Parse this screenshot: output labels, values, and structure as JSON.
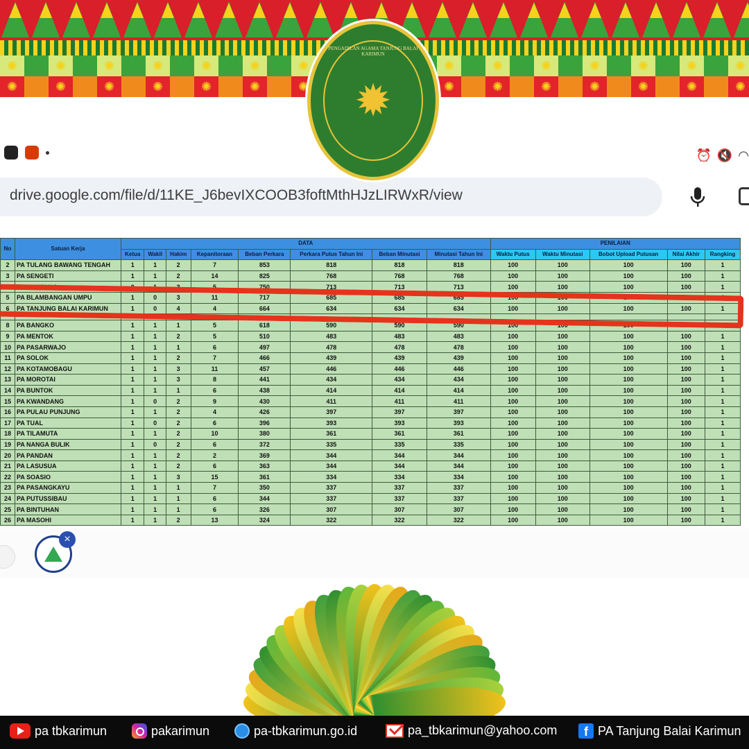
{
  "logo": {
    "text": "PENGADILAN AGAMA TANJUNG BALAI KARIMUN"
  },
  "browser": {
    "url": "drive.google.com/file/d/11KE_J6bevIXCOOB3foftMthHJzLIRWxR/view"
  },
  "sheet": {
    "group_headers": {
      "data": "DATA",
      "penilaian": "PENILAIAN"
    },
    "col_no": "No",
    "col_satuan": "Satuan Kerja",
    "columns": [
      "Ketua",
      "Wakil",
      "Hakim",
      "Kepanitoraan",
      "Beban Perkara",
      "Perkara Putus Tahun Ini",
      "Beban Minutasi",
      "Minutasi Tahun Ini",
      "Waktu Putus",
      "Waktu Minutasi",
      "Bobot Upload Putusan",
      "Nilai Akhir",
      "Rangking"
    ],
    "rows": [
      [
        "2",
        "PA TULANG BAWANG TENGAH",
        "1",
        "1",
        "2",
        "7",
        "853",
        "818",
        "818",
        "818",
        "100",
        "100",
        "100",
        "100",
        "1"
      ],
      [
        "3",
        "PA SENGETI",
        "1",
        "1",
        "2",
        "14",
        "825",
        "768",
        "768",
        "768",
        "100",
        "100",
        "100",
        "100",
        "1"
      ],
      [
        "4",
        "PA BONTANG",
        "0",
        "1",
        "3",
        "5",
        "750",
        "713",
        "713",
        "713",
        "100",
        "100",
        "100",
        "100",
        "1"
      ],
      [
        "5",
        "PA BLAMBANGAN UMPU",
        "1",
        "0",
        "3",
        "11",
        "717",
        "685",
        "685",
        "685",
        "100",
        "100",
        "100",
        "100",
        "1"
      ],
      [
        "6",
        "PA TANJUNG BALAI KARIMUN",
        "1",
        "0",
        "4",
        "4",
        "664",
        "634",
        "634",
        "634",
        "100",
        "100",
        "100",
        "100",
        "1"
      ],
      [
        "",
        "",
        "",
        "",
        "",
        "",
        "",
        "",
        "",
        "",
        "",
        "",
        "",
        "",
        ""
      ],
      [
        "8",
        "PA BANGKO",
        "1",
        "1",
        "1",
        "5",
        "618",
        "590",
        "590",
        "590",
        "100",
        "100",
        "100",
        "100",
        "1"
      ],
      [
        "9",
        "PA MENTOK",
        "1",
        "1",
        "2",
        "5",
        "510",
        "483",
        "483",
        "483",
        "100",
        "100",
        "100",
        "100",
        "1"
      ],
      [
        "10",
        "PA PASARWAJO",
        "1",
        "1",
        "1",
        "6",
        "497",
        "478",
        "478",
        "478",
        "100",
        "100",
        "100",
        "100",
        "1"
      ],
      [
        "11",
        "PA SOLOK",
        "1",
        "1",
        "2",
        "7",
        "466",
        "439",
        "439",
        "439",
        "100",
        "100",
        "100",
        "100",
        "1"
      ],
      [
        "12",
        "PA KOTAMOBAGU",
        "1",
        "1",
        "3",
        "11",
        "457",
        "446",
        "446",
        "446",
        "100",
        "100",
        "100",
        "100",
        "1"
      ],
      [
        "13",
        "PA MOROTAI",
        "1",
        "1",
        "3",
        "8",
        "441",
        "434",
        "434",
        "434",
        "100",
        "100",
        "100",
        "100",
        "1"
      ],
      [
        "14",
        "PA BUNTOK",
        "1",
        "1",
        "1",
        "6",
        "438",
        "414",
        "414",
        "414",
        "100",
        "100",
        "100",
        "100",
        "1"
      ],
      [
        "15",
        "PA KWANDANG",
        "1",
        "0",
        "2",
        "9",
        "430",
        "411",
        "411",
        "411",
        "100",
        "100",
        "100",
        "100",
        "1"
      ],
      [
        "16",
        "PA PULAU PUNJUNG",
        "1",
        "1",
        "2",
        "4",
        "426",
        "397",
        "397",
        "397",
        "100",
        "100",
        "100",
        "100",
        "1"
      ],
      [
        "17",
        "PA TUAL",
        "1",
        "0",
        "2",
        "6",
        "396",
        "393",
        "393",
        "393",
        "100",
        "100",
        "100",
        "100",
        "1"
      ],
      [
        "18",
        "PA TILAMUTA",
        "1",
        "1",
        "2",
        "10",
        "380",
        "361",
        "361",
        "361",
        "100",
        "100",
        "100",
        "100",
        "1"
      ],
      [
        "19",
        "PA NANGA BULIK",
        "1",
        "0",
        "2",
        "6",
        "372",
        "335",
        "335",
        "335",
        "100",
        "100",
        "100",
        "100",
        "1"
      ],
      [
        "20",
        "PA PANDAN",
        "1",
        "1",
        "2",
        "2",
        "369",
        "344",
        "344",
        "344",
        "100",
        "100",
        "100",
        "100",
        "1"
      ],
      [
        "21",
        "PA LASUSUA",
        "1",
        "1",
        "2",
        "6",
        "363",
        "344",
        "344",
        "344",
        "100",
        "100",
        "100",
        "100",
        "1"
      ],
      [
        "22",
        "PA SOASIO",
        "1",
        "1",
        "3",
        "15",
        "361",
        "334",
        "334",
        "334",
        "100",
        "100",
        "100",
        "100",
        "1"
      ],
      [
        "23",
        "PA PASANGKAYU",
        "1",
        "1",
        "1",
        "7",
        "350",
        "337",
        "337",
        "337",
        "100",
        "100",
        "100",
        "100",
        "1"
      ],
      [
        "24",
        "PA PUTUSSIBAU",
        "1",
        "1",
        "1",
        "6",
        "344",
        "337",
        "337",
        "337",
        "100",
        "100",
        "100",
        "100",
        "1"
      ],
      [
        "25",
        "PA BINTUHAN",
        "1",
        "1",
        "1",
        "6",
        "326",
        "307",
        "307",
        "307",
        "100",
        "100",
        "100",
        "100",
        "1"
      ],
      [
        "26",
        "PA MASOHI",
        "1",
        "1",
        "2",
        "13",
        "324",
        "322",
        "322",
        "322",
        "100",
        "100",
        "100",
        "100",
        "1"
      ]
    ]
  },
  "footer": {
    "youtube": "pa tbkarimun",
    "instagram": "pakarimun",
    "website": "pa-tbkarimun.go.id",
    "email": "pa_tbkarimun@yahoo.com",
    "facebook": "PA Tanjung Balai Karimun"
  },
  "colors": {
    "highlight": "#e5331c",
    "header_blue": "#3d8fe2",
    "row_green": "#bfe0b6"
  }
}
